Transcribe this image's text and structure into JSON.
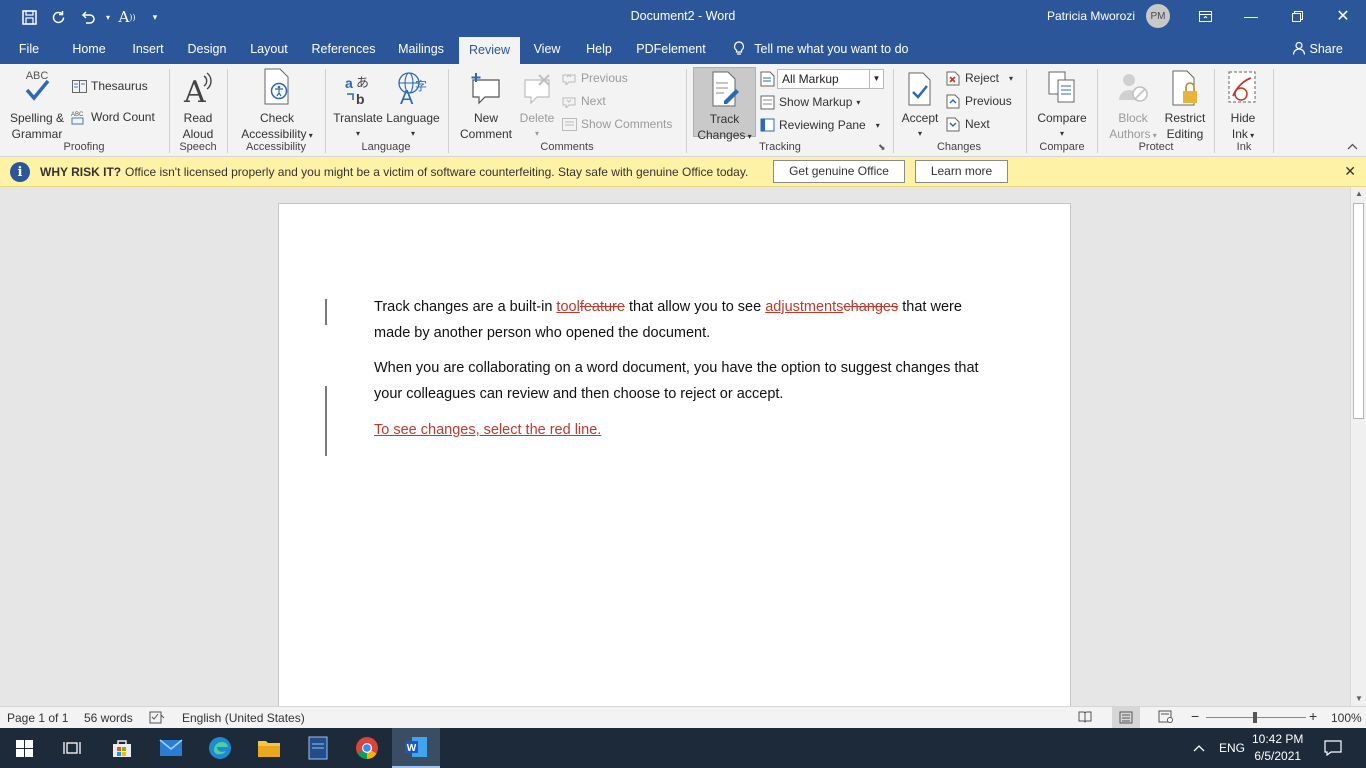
{
  "titlebar": {
    "doc_title": "Document2  -  Word",
    "user_name": "Patricia Mworozi",
    "user_initials": "PM"
  },
  "tabs": [
    "File",
    "Home",
    "Insert",
    "Design",
    "Layout",
    "References",
    "Mailings",
    "Review",
    "View",
    "Help",
    "PDFelement"
  ],
  "active_tab": "Review",
  "tell_me": "Tell me what you want to do",
  "share": "Share",
  "ribbon": {
    "proofing": {
      "spelling_l1": "Spelling &",
      "spelling_l2": "Grammar",
      "thesaurus": "Thesaurus",
      "word_count": "Word Count",
      "label": "Proofing",
      "abc_icon_text": "ABC"
    },
    "speech": {
      "read_l1": "Read",
      "read_l2": "Aloud",
      "label": "Speech"
    },
    "accessibility": {
      "check_l1": "Check",
      "check_l2": "Accessibility",
      "label": "Accessibility"
    },
    "language": {
      "translate": "Translate",
      "language": "Language",
      "label": "Language"
    },
    "comments": {
      "new_l1": "New",
      "new_l2": "Comment",
      "delete": "Delete",
      "previous": "Previous",
      "next": "Next",
      "show_comments": "Show Comments",
      "label": "Comments"
    },
    "tracking": {
      "track_l1": "Track",
      "track_l2": "Changes",
      "markup_value": "All Markup",
      "show_markup": "Show Markup",
      "reviewing_pane": "Reviewing Pane",
      "label": "Tracking"
    },
    "changes": {
      "accept": "Accept",
      "reject": "Reject",
      "previous": "Previous",
      "next": "Next",
      "label": "Changes"
    },
    "compare": {
      "compare": "Compare",
      "label": "Compare"
    },
    "protect": {
      "block_l1": "Block",
      "block_l2": "Authors",
      "restrict_l1": "Restrict",
      "restrict_l2": "Editing",
      "label": "Protect"
    },
    "ink": {
      "hide_l1": "Hide",
      "hide_l2": "Ink",
      "label": "Ink"
    }
  },
  "notification": {
    "title": "WHY RISK IT?",
    "message": "Office isn't licensed properly and you might be a victim of software counterfeiting. Stay safe with genuine Office today.",
    "get_genuine": "Get genuine Office",
    "learn_more": "Learn more"
  },
  "document": {
    "p1_a": "Track changes are a built-in ",
    "p1_ins1": "tool",
    "p1_del1": "feature",
    "p1_b": " that allow you to see ",
    "p1_ins2": "adjustments",
    "p1_del2": "changes",
    "p1_c": " that were made by another person who opened the document.",
    "p2": "When you are collaborating on a word document, you have the option to suggest changes that your colleagues can review and then choose to reject or accept.",
    "p3_ins": "To see changes, select the red line."
  },
  "statusbar": {
    "page": "Page 1 of 1",
    "words": "56 words",
    "language": "English (United States)",
    "zoom": "100%"
  },
  "taskbar": {
    "lang": "ENG",
    "time": "10:42 PM",
    "date": "6/5/2021"
  },
  "colors": {
    "word_blue": "#2b579a",
    "insertion_red": "#c0392b",
    "notify_yellow": "#fdf2a5"
  }
}
